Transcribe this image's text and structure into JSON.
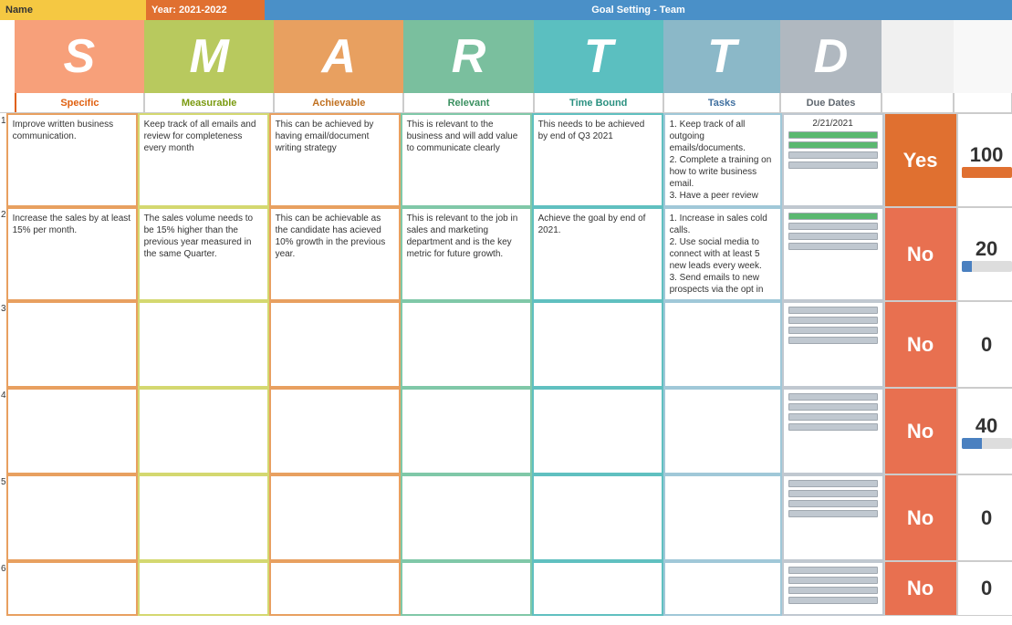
{
  "header": {
    "name_label": "Name",
    "year_label": "Year: 2021-2022",
    "title": "Goal Setting - Team"
  },
  "smart": {
    "s": "S",
    "m": "M",
    "a": "A",
    "r": "R",
    "t": "T",
    "t2": "T",
    "d": "D"
  },
  "columns": {
    "specific": "Specific",
    "measurable": "Measurable",
    "achievable": "Achievable",
    "relevant": "Relevant",
    "timebound": "Time Bound",
    "tasks": "Tasks",
    "duedates": "Due Dates"
  },
  "rows": [
    {
      "num": "1",
      "specific": "Improve written business communication.",
      "measurable": "Keep track of all emails and review for completeness every month",
      "achievable": "This can be achieved by having email/document writing strategy",
      "relevant": "This is relevant to the business and will add value to communicate clearly",
      "timebound": "This needs to be achieved by end of Q3 2021",
      "tasks": "1. Keep track of all outgoing emails/documents.\n2. Complete a training on how to write business email.\n3. Have a peer review",
      "due_date": "2/21/2021",
      "status": "Yes",
      "score": "100",
      "score_fill": 100
    },
    {
      "num": "2",
      "specific": "Increase the sales by at least 15% per month.",
      "measurable": "The sales volume needs to be 15% higher than the previous year measured in the same Quarter.",
      "achievable": "This can be achievable as the candidate has acieved 10% growth in the previous year.",
      "relevant": "This is relevant to the job in sales and marketing department and is the key metric for future growth.",
      "timebound": "Achieve the goal by end of 2021.",
      "tasks": "1. Increase in sales cold calls.\n2. Use social media to connect with at least 5 new leads every week.\n3. Send emails to new prospects via the opt in",
      "due_date": "",
      "status": "No",
      "score": "20",
      "score_fill": 20
    },
    {
      "num": "3",
      "specific": "",
      "measurable": "",
      "achievable": "",
      "relevant": "",
      "timebound": "",
      "tasks": "",
      "due_date": "",
      "status": "No",
      "score": "0",
      "score_fill": 0
    },
    {
      "num": "4",
      "specific": "",
      "measurable": "",
      "achievable": "",
      "relevant": "",
      "timebound": "",
      "tasks": "",
      "due_date": "",
      "status": "No",
      "score": "40",
      "score_fill": 40
    },
    {
      "num": "5",
      "specific": "",
      "measurable": "",
      "achievable": "",
      "relevant": "",
      "timebound": "",
      "tasks": "",
      "due_date": "",
      "status": "No",
      "score": "0",
      "score_fill": 0
    },
    {
      "num": "6",
      "specific": "",
      "measurable": "",
      "achievable": "",
      "relevant": "",
      "timebound": "",
      "tasks": "",
      "due_date": "",
      "status": "No",
      "score": "0",
      "score_fill": 0
    }
  ]
}
